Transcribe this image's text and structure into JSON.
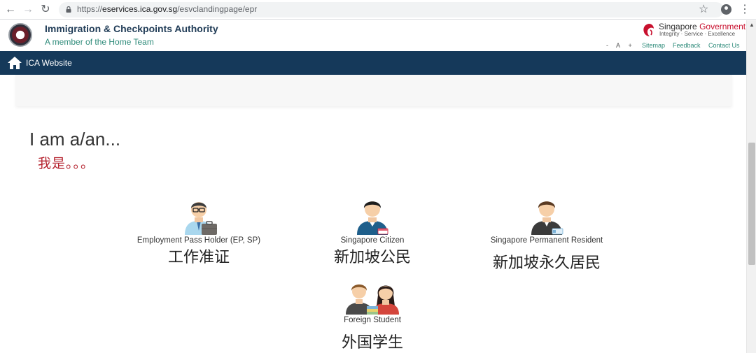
{
  "browser": {
    "url_prefix": "https://",
    "url_host": "eservices.ica.gov.sg",
    "url_path": "/esvclandingpage/epr",
    "back_icon": "arrow-left-icon",
    "forward_icon": "arrow-right-icon",
    "reload_icon": "reload-icon",
    "lock_icon": "lock-icon",
    "bookmark_icon": "star-icon",
    "account_icon": "account-icon",
    "menu_icon": "kebab-menu-icon"
  },
  "header": {
    "title": "Immigration & Checkpoints Authority",
    "tagline": "A member of the Home Team",
    "sg_singapore": "Singapore",
    "sg_government": "Government",
    "sg_motto": "Integrity · Service · Excellence",
    "font_decrease": "-",
    "font_default": "A",
    "font_increase": "+",
    "links": {
      "sitemap": "Sitemap",
      "feedback": "Feedback",
      "contact": "Contact Us"
    },
    "accent_color": "#15395a",
    "brand_red": "#c8102e"
  },
  "navbar": {
    "home_label": "ICA Website"
  },
  "main": {
    "heading": "I am a/an...",
    "heading_cn": "我是。。。",
    "options": [
      {
        "caption": "Employment Pass Holder (EP, SP)",
        "cn": "工作准证",
        "icon": "employment-pass-holder-icon"
      },
      {
        "caption": "Singapore Citizen",
        "cn": "新加坡公民",
        "icon": "singapore-citizen-icon"
      },
      {
        "caption": "Singapore Permanent Resident",
        "cn": "新加坡永久居民",
        "icon": "permanent-resident-icon"
      },
      {
        "caption": "Foreign Student",
        "cn": "外国学生",
        "icon": "foreign-student-icon"
      }
    ]
  }
}
